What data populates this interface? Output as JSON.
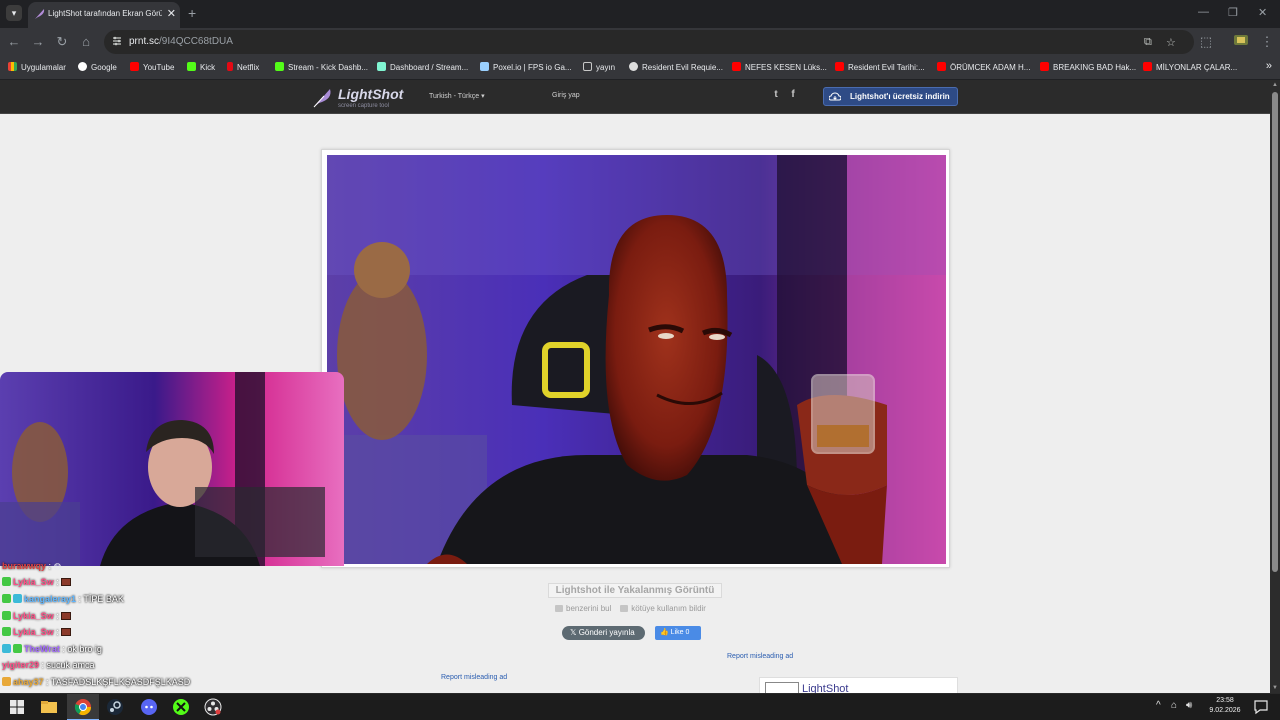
{
  "browser": {
    "tab_title": "LightShot tarafından Ekran Görüntüsü",
    "close_glyph": "✕",
    "new_tab_glyph": "+",
    "url_host": "prnt.sc",
    "url_path": "/9I4QCC68tDUA",
    "window_controls": [
      "—",
      "❐",
      "✕"
    ]
  },
  "bookmarks": [
    {
      "label": "Uygulamalar",
      "color": "#e94235"
    },
    {
      "label": "Google",
      "color": "#ffffff"
    },
    {
      "label": "YouTube",
      "color": "#ff0000"
    },
    {
      "label": "Kick",
      "color": "#53fc18"
    },
    {
      "label": "Netflix",
      "color": "#e50914"
    },
    {
      "label": "Stream - Kick Dashb...",
      "color": "#53fc18"
    },
    {
      "label": "Dashboard / Stream...",
      "color": "#ffffff"
    },
    {
      "label": "Poxel.io | FPS io Ga...",
      "color": "#9ad0ff"
    },
    {
      "label": "yayın",
      "color": "#aaaaaa"
    },
    {
      "label": "Resident Evil Requie...",
      "color": "#ffffff"
    },
    {
      "label": "NEFES KESEN Lüks...",
      "color": "#ff0000"
    },
    {
      "label": "Resident Evil Tarihi:...",
      "color": "#ff0000"
    },
    {
      "label": "ÖRÜMCEK ADAM H...",
      "color": "#ff0000"
    },
    {
      "label": "BREAKING BAD Hak...",
      "color": "#ff0000"
    },
    {
      "label": "MİLYONLAR ÇALAR...",
      "color": "#ff0000"
    }
  ],
  "bookmarks_more": "»",
  "lightshot": {
    "logo_name": "LightShot",
    "logo_tagline": "screen capture tool",
    "language": "Turkish - Türkçe",
    "language_caret": "▾",
    "login": "Giriş yap",
    "twitter_glyph": "t",
    "facebook_glyph": "f",
    "download_button": "Lightshot'ı ücretsiz indirin",
    "caption": "Lightshot ile Yakalanmış Görüntü",
    "find_similar": "benzerini bul",
    "report_abuse": "kötüye kullanım bildir",
    "tweet_button": "Gönderi yayınla",
    "tweet_glyph": "𝕏",
    "like_button": "Like 0",
    "report_ad_1": "Report misleading ad",
    "report_ad_2": "Report misleading ad",
    "ad_brand": "LightShot"
  },
  "chat": [
    {
      "user": "burawwqy",
      "msg": "",
      "color": "#e04040",
      "badge": "",
      "emote": false,
      "partial": true
    },
    {
      "user": "Lykia_Sw",
      "msg": "",
      "color": "#ff4f87",
      "badge": "#44c844",
      "emote": true
    },
    {
      "user": "kangaleray1",
      "msg": "TİPE BAK",
      "color": "#5fb7ff",
      "badge": "#3cbad8",
      "emote": false
    },
    {
      "user": "Lykia_Sw",
      "msg": "",
      "color": "#ff4f87",
      "badge": "#44c844",
      "emote": true
    },
    {
      "user": "Lykia_Sw",
      "msg": "",
      "color": "#ff4f87",
      "badge": "#44c844",
      "emote": true
    },
    {
      "user": "TheWrat",
      "msg": "ok bro ig",
      "color": "#a46bff",
      "badge": "#3cbad8",
      "emote": false
    },
    {
      "user": "yigiter29",
      "msg": "sucuk amca",
      "color": "#ff4f87",
      "badge": "",
      "emote": false
    },
    {
      "user": "ahay37",
      "msg": "TASFADSLKŞFLKŞASDFŞLKASD",
      "color": "#e8a838",
      "badge": "#e8a838",
      "emote": false
    }
  ],
  "taskbar": {
    "time": "23:58",
    "date": "9.02.2026",
    "tray_caret": "^"
  }
}
